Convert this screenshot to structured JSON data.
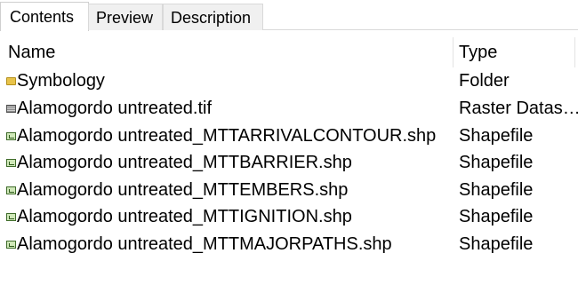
{
  "tabs": [
    {
      "label": "Contents",
      "active": true
    },
    {
      "label": "Preview",
      "active": false
    },
    {
      "label": "Description",
      "active": false
    }
  ],
  "columns": {
    "name": "Name",
    "type": "Type"
  },
  "rows": [
    {
      "name": "Symbology",
      "type": "Folder",
      "icon": "folder-icon"
    },
    {
      "name": "Alamogordo untreated.tif",
      "type": "Raster Datas…",
      "icon": "raster-icon"
    },
    {
      "name": "Alamogordo untreated_MTTARRIVALCONTOUR.shp",
      "type": "Shapefile",
      "icon": "shapefile-icon"
    },
    {
      "name": "Alamogordo untreated_MTTBARRIER.shp",
      "type": "Shapefile",
      "icon": "shapefile-icon"
    },
    {
      "name": "Alamogordo untreated_MTTEMBERS.shp",
      "type": "Shapefile",
      "icon": "shapefile-icon"
    },
    {
      "name": "Alamogordo untreated_MTTIGNITION.shp",
      "type": "Shapefile",
      "icon": "shapefile-icon"
    },
    {
      "name": "Alamogordo untreated_MTTMAJORPATHS.shp",
      "type": "Shapefile",
      "icon": "shapefile-icon"
    }
  ]
}
